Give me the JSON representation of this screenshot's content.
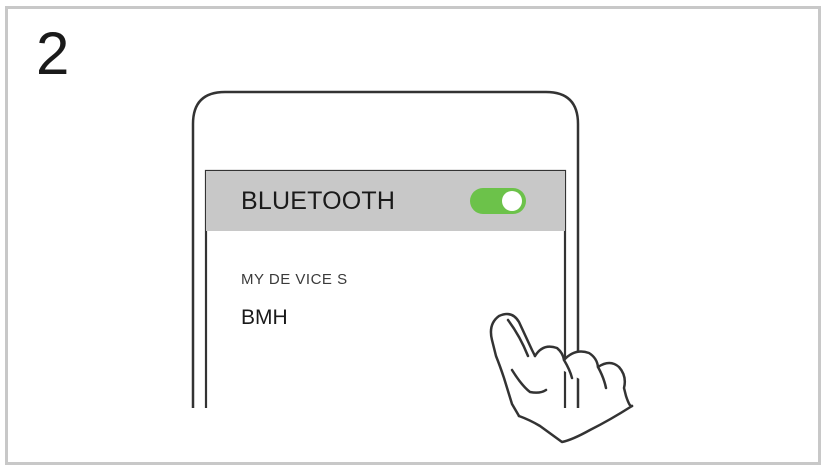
{
  "step": {
    "number": "2"
  },
  "settings": {
    "header_title": "BLUETOOTH",
    "bluetooth_enabled": true,
    "section_label": "MY DE VICE S",
    "device_name": "BMH"
  },
  "colors": {
    "toggle_on": "#6cc24a",
    "header_bg": "#c8c8c8",
    "frame_border": "#c8c8c8",
    "line_art": "#333333"
  },
  "icons": {
    "hand": "pointing-hand-icon"
  }
}
